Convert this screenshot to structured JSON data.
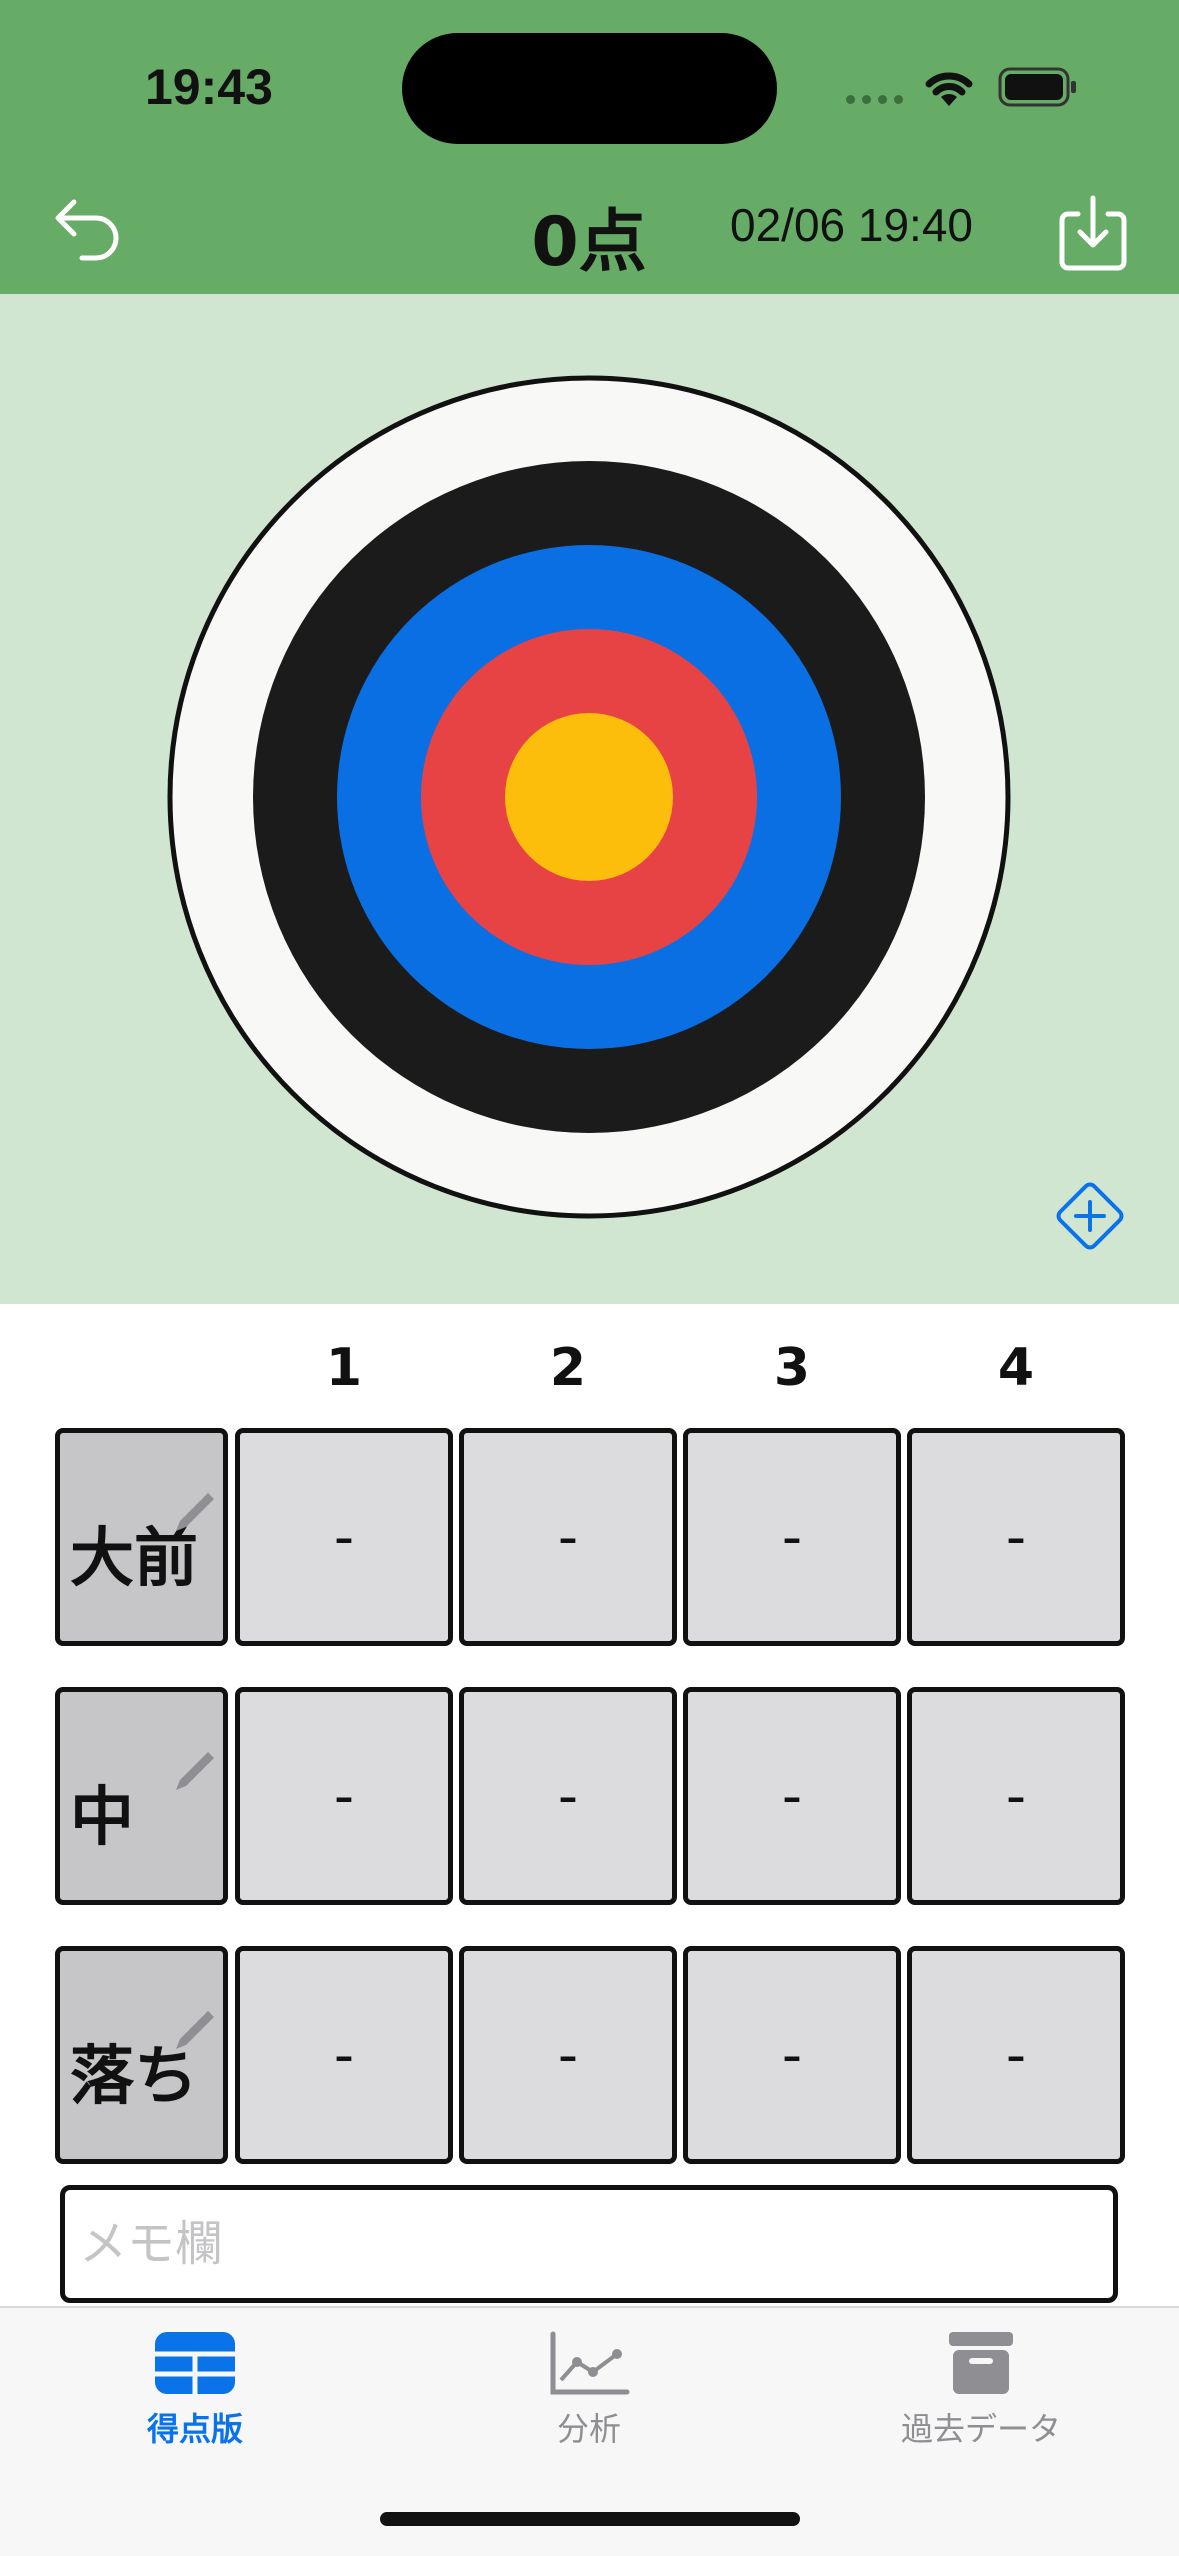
{
  "status_bar": {
    "time": "19:43"
  },
  "nav": {
    "title": "0点",
    "datetime": "02/06 19:40"
  },
  "target": {
    "ring_colors": [
      "#f8f9f7",
      "#1b1b1b",
      "#0a6fe2",
      "#e74345",
      "#fdbd0b"
    ]
  },
  "grid": {
    "columns": [
      "1",
      "2",
      "3",
      "4"
    ],
    "rows": [
      {
        "label": "大前",
        "cells": [
          "-",
          "-",
          "-",
          "-"
        ]
      },
      {
        "label": "中",
        "cells": [
          "-",
          "-",
          "-",
          "-"
        ]
      },
      {
        "label": "落ち",
        "cells": [
          "-",
          "-",
          "-",
          "-"
        ]
      }
    ]
  },
  "memo": {
    "placeholder": "メモ欄",
    "value": ""
  },
  "tabs": [
    {
      "label": "得点版",
      "icon": "grid-icon",
      "active": true
    },
    {
      "label": "分析",
      "icon": "line-chart-icon",
      "active": false
    },
    {
      "label": "過去データ",
      "icon": "archive-box-icon",
      "active": false
    }
  ],
  "colors": {
    "header": "#66ab66",
    "target_bg": "#d1e6d1",
    "accent": "#0a73ea",
    "inactive": "#8e8e93"
  }
}
